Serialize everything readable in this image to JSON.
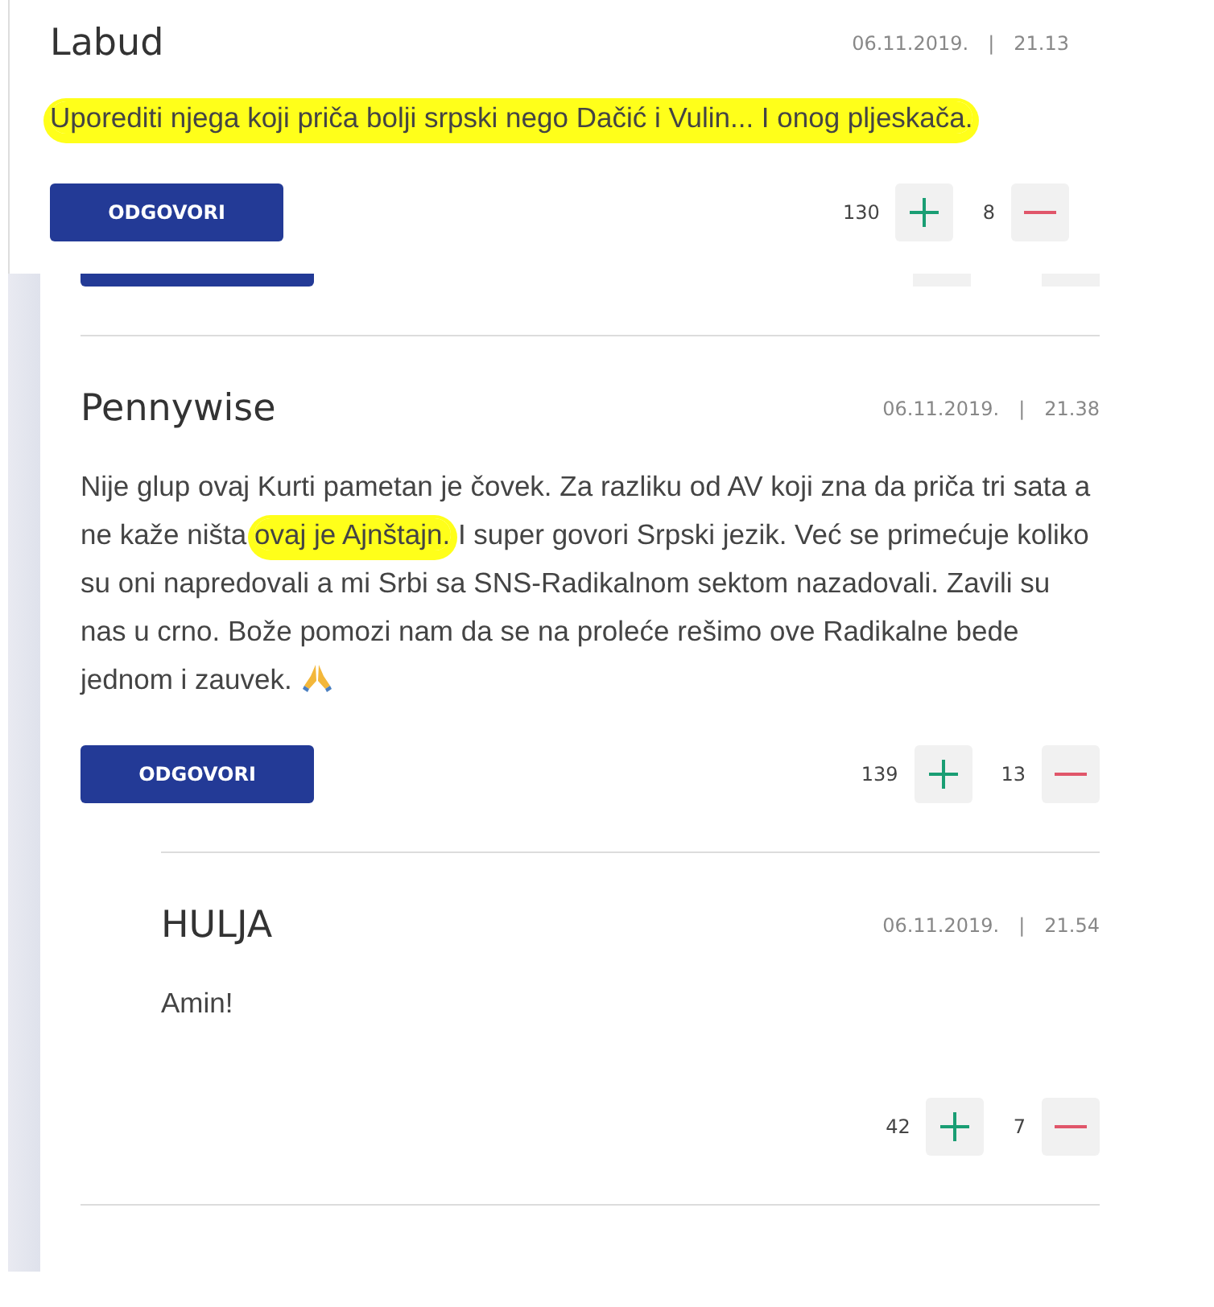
{
  "overlay_comment": {
    "author": "Labud",
    "date": "06.11.2019.",
    "separator": "|",
    "time": "21.13",
    "body": [
      {
        "text": "Uporediti njega koji priča bolji srpski nego Dačić i Vulin... I onog pljeskača.",
        "highlighted": true
      }
    ],
    "reply_button": "ODGOVORI",
    "upvotes": "130",
    "downvotes": "8"
  },
  "comments": [
    {
      "author": "Pennywise",
      "date": "06.11.2019.",
      "separator": "|",
      "time": "21.38",
      "body": [
        {
          "text": "Nije glup ovaj Kurti pametan je čovek. Za razliku od AV koji zna da priča tri sata a ne kaže ništa ",
          "highlighted": false
        },
        {
          "text": "ovaj je Ajnštajn.",
          "highlighted": true
        },
        {
          "text": " I super govori Srpski jezik. Već se primećuje koliko su oni napredovali a mi Srbi sa SNS-Radikalnom sektom nazadovali. Zavili su nas u crno. Bože pomozi nam da se na proleće rešimo ove Radikalne bede jednom i zauvek.",
          "highlighted": false
        }
      ],
      "emoji": true,
      "reply_button": "ODGOVORI",
      "upvotes": "139",
      "downvotes": "13",
      "replies": [
        {
          "author": "HULJA",
          "date": "06.11.2019.",
          "separator": "|",
          "time": "21.54",
          "body": [
            {
              "text": "Amin!",
              "highlighted": false
            }
          ],
          "upvotes": "42",
          "downvotes": "7"
        }
      ]
    }
  ]
}
